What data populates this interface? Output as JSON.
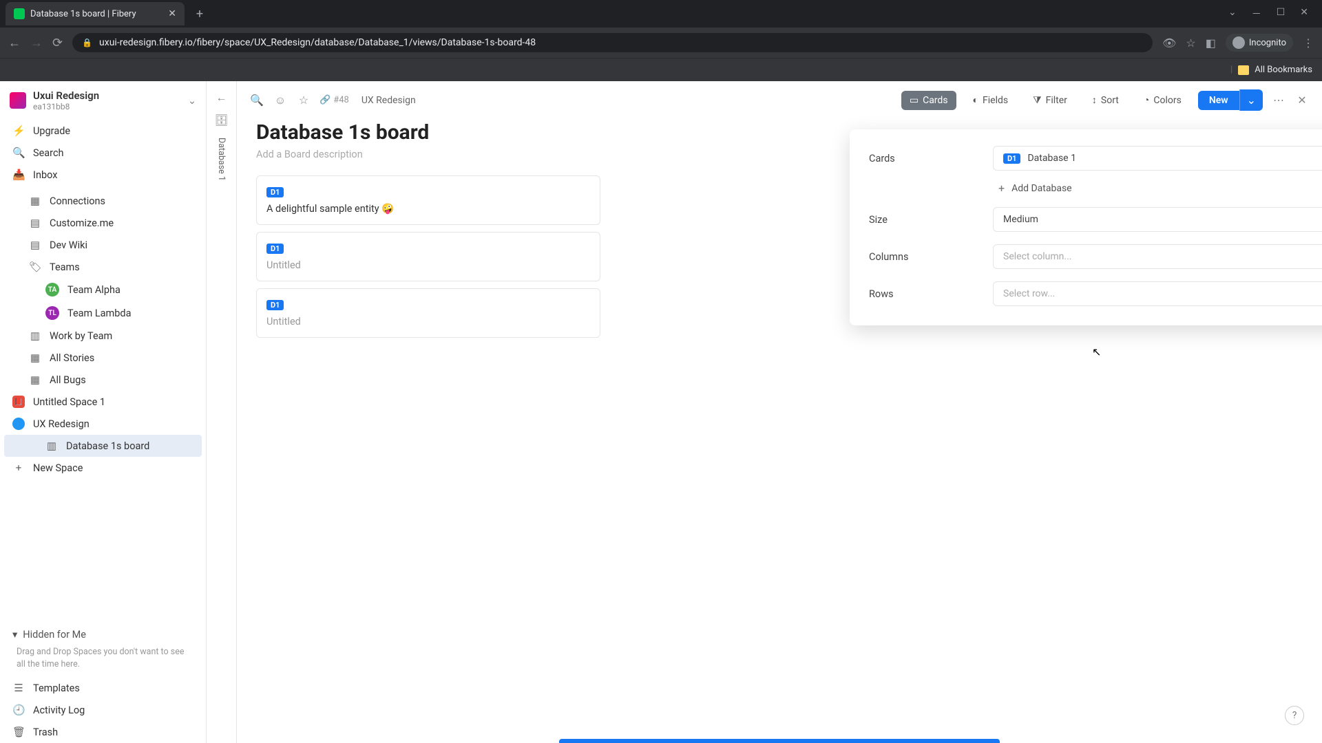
{
  "browser": {
    "tab_title": "Database 1s board | Fibery",
    "url": "uxui-redesign.fibery.io/fibery/space/UX_Redesign/database/Database_1/views/Database-1s-board-48",
    "incognito_label": "Incognito",
    "bookmarks_label": "All Bookmarks"
  },
  "workspace": {
    "name": "Uxui Redesign",
    "id": "ea131bb8"
  },
  "sidebar": {
    "upgrade": "Upgrade",
    "search": "Search",
    "inbox": "Inbox",
    "connections": "Connections",
    "customize": "Customize.me",
    "devwiki": "Dev Wiki",
    "teams": "Teams",
    "team_alpha": "Team Alpha",
    "team_lambda": "Team Lambda",
    "work_by_team": "Work by Team",
    "all_stories": "All Stories",
    "all_bugs": "All Bugs",
    "untitled_space": "Untitled Space 1",
    "ux_redesign": "UX Redesign",
    "db_board": "Database 1s board",
    "new_space": "New Space",
    "hidden_header": "Hidden for Me",
    "hidden_hint": "Drag and Drop Spaces you don't want to see all the time here.",
    "templates": "Templates",
    "activity_log": "Activity Log",
    "trash": "Trash"
  },
  "rail": {
    "label": "Database 1"
  },
  "toolbar": {
    "crumb_id": "#48",
    "crumb_name": "UX Redesign",
    "cards": "Cards",
    "fields": "Fields",
    "filter": "Filter",
    "sort": "Sort",
    "colors": "Colors",
    "new": "New"
  },
  "page": {
    "title": "Database 1s board",
    "desc_placeholder": "Add a Board description"
  },
  "cards": [
    {
      "badge": "D1",
      "title": "A delightful sample entity 🤪",
      "untitled": false
    },
    {
      "badge": "D1",
      "title": "Untitled",
      "untitled": true
    },
    {
      "badge": "D1",
      "title": "Untitled",
      "untitled": true
    }
  ],
  "popover": {
    "cards_label": "Cards",
    "cards_value": "Database 1",
    "cards_badge": "D1",
    "add_db": "Add Database",
    "size_label": "Size",
    "size_value": "Medium",
    "columns_label": "Columns",
    "columns_placeholder": "Select column...",
    "rows_label": "Rows",
    "rows_placeholder": "Select row..."
  }
}
